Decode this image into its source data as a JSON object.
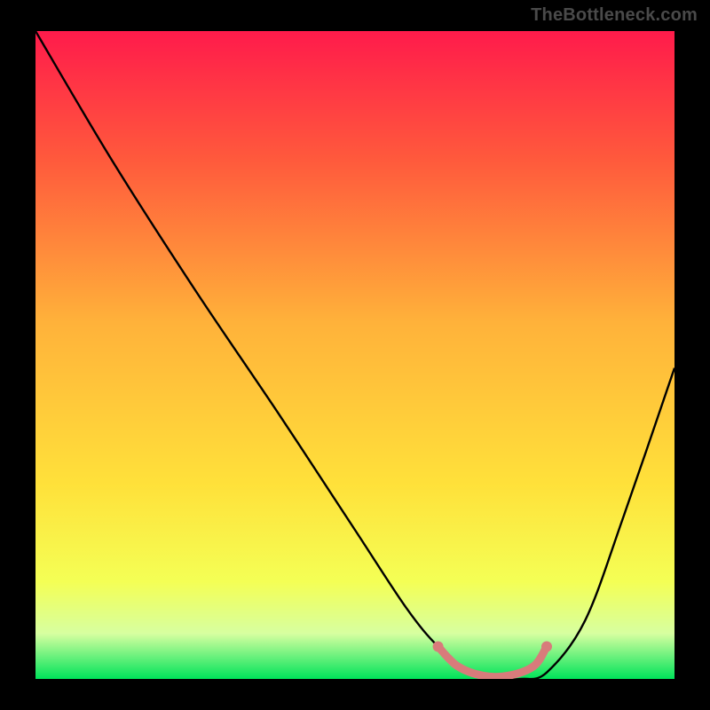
{
  "watermark": "TheBottleneck.com",
  "chart_data": {
    "type": "line",
    "title": "",
    "xlabel": "",
    "ylabel": "",
    "xlim": [
      0,
      100
    ],
    "ylim": [
      0,
      100
    ],
    "grid": false,
    "legend": false,
    "gradient_stops": [
      {
        "offset": 0.0,
        "color": "#ff1b4b"
      },
      {
        "offset": 0.2,
        "color": "#ff5a3c"
      },
      {
        "offset": 0.45,
        "color": "#ffb23a"
      },
      {
        "offset": 0.7,
        "color": "#ffe13a"
      },
      {
        "offset": 0.85,
        "color": "#f4ff55"
      },
      {
        "offset": 0.93,
        "color": "#d7ffa0"
      },
      {
        "offset": 1.0,
        "color": "#00e35a"
      }
    ],
    "series": [
      {
        "name": "bottleneck-curve",
        "color": "#000000",
        "x": [
          0,
          12,
          25,
          38,
          50,
          58,
          63,
          68,
          72,
          76,
          80,
          86,
          92,
          100
        ],
        "y": [
          100,
          80,
          60,
          41,
          23,
          11,
          5,
          1,
          0,
          0,
          1,
          9,
          25,
          48
        ]
      }
    ],
    "highlight_segment": {
      "name": "optimal-range",
      "color": "#d87b7b",
      "x": [
        63,
        66,
        70,
        74,
        78,
        80
      ],
      "y": [
        5,
        2,
        0.5,
        0.5,
        2,
        5
      ],
      "endpoint_left": {
        "x": 63,
        "y": 5
      },
      "endpoint_right": {
        "x": 80,
        "y": 5
      }
    }
  }
}
